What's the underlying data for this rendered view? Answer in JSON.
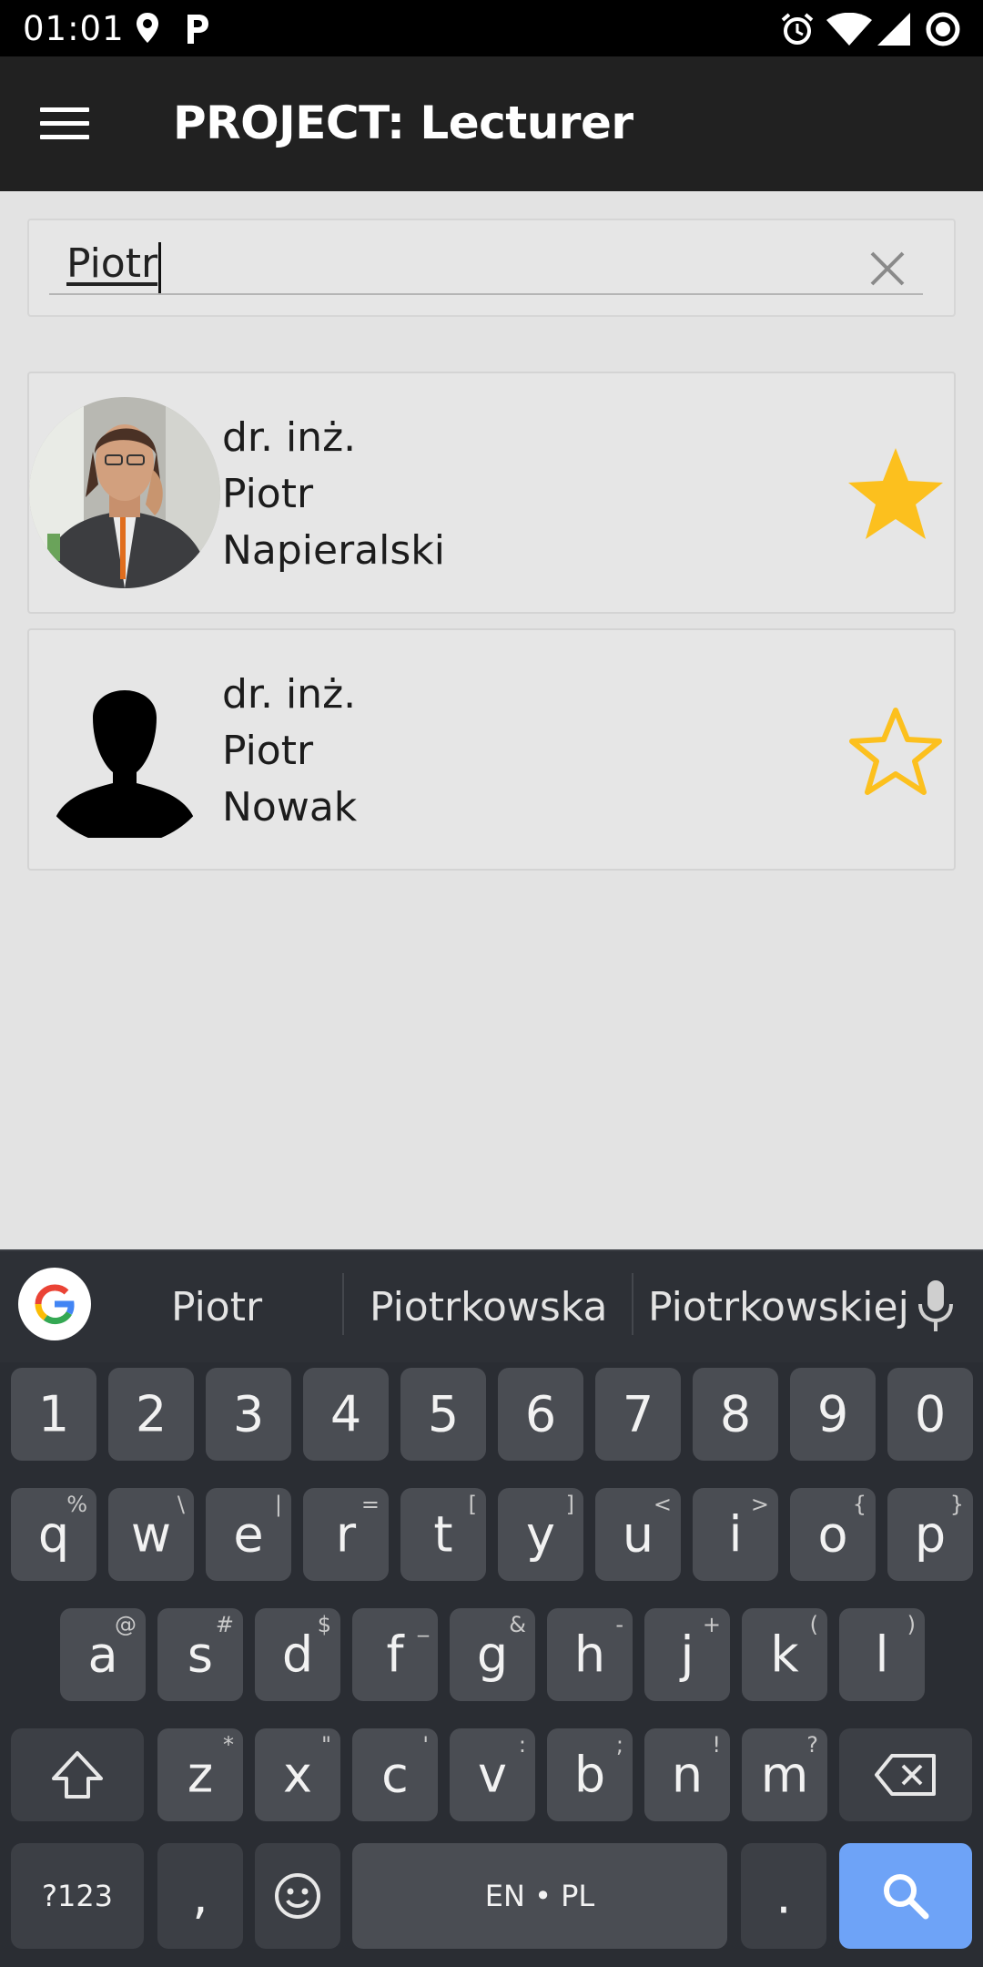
{
  "status_bar": {
    "time": "01:01",
    "left_icons": [
      "location-icon",
      "parking-icon"
    ],
    "right_icons": [
      "alarm-icon",
      "wifi-icon",
      "signal-icon",
      "circle-icon"
    ]
  },
  "app_bar": {
    "title": "PROJECT: Lecturer"
  },
  "search": {
    "value": "Piotr"
  },
  "results": [
    {
      "title": "dr. inż.",
      "first_name": "Piotr",
      "last_name": "Napieralski",
      "avatar": "photo",
      "favorite": true
    },
    {
      "title": "dr. inż.",
      "first_name": "Piotr",
      "last_name": "Nowak",
      "avatar": "silhouette",
      "favorite": false
    }
  ],
  "keyboard": {
    "suggestions": [
      "Piotr",
      "Piotrkowska",
      "Piotrkowskiej"
    ],
    "numbers": [
      "1",
      "2",
      "3",
      "4",
      "5",
      "6",
      "7",
      "8",
      "9",
      "0"
    ],
    "row1": [
      {
        "k": "q",
        "h": "%"
      },
      {
        "k": "w",
        "h": "\\"
      },
      {
        "k": "e",
        "h": "|"
      },
      {
        "k": "r",
        "h": "="
      },
      {
        "k": "t",
        "h": "["
      },
      {
        "k": "y",
        "h": "]"
      },
      {
        "k": "u",
        "h": "<"
      },
      {
        "k": "i",
        "h": ">"
      },
      {
        "k": "o",
        "h": "{"
      },
      {
        "k": "p",
        "h": "}"
      }
    ],
    "row2": [
      {
        "k": "a",
        "h": "@"
      },
      {
        "k": "s",
        "h": "#"
      },
      {
        "k": "d",
        "h": "$"
      },
      {
        "k": "f",
        "h": "_"
      },
      {
        "k": "g",
        "h": "&"
      },
      {
        "k": "h",
        "h": "-"
      },
      {
        "k": "j",
        "h": "+"
      },
      {
        "k": "k",
        "h": "("
      },
      {
        "k": "l",
        "h": ")"
      }
    ],
    "row3": [
      {
        "k": "z",
        "h": "*"
      },
      {
        "k": "x",
        "h": "\""
      },
      {
        "k": "c",
        "h": "'"
      },
      {
        "k": "v",
        "h": ":"
      },
      {
        "k": "b",
        "h": ";"
      },
      {
        "k": "n",
        "h": "!"
      },
      {
        "k": "m",
        "h": "?"
      }
    ],
    "symbols_label": "?123",
    "comma": ",",
    "space_label": "EN • PL",
    "period": ".",
    "accent_color": "#6ea3f7"
  }
}
